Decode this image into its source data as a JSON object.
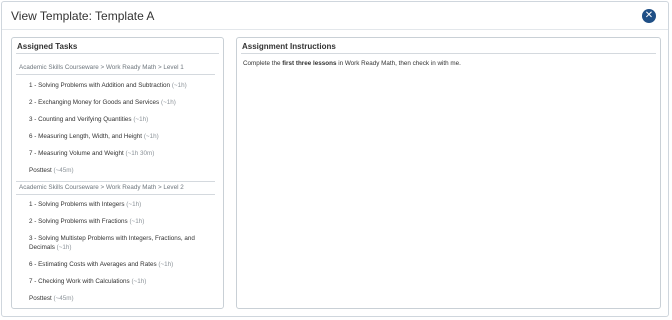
{
  "dialog": {
    "title": "View Template: Template A",
    "close_icon": "close-icon"
  },
  "tasks_panel": {
    "title": "Assigned Tasks",
    "groups": [
      {
        "header": "Academic Skills Courseware > Work Ready Math > Level 1",
        "tasks": [
          {
            "label": "1 - Solving Problems with Addition and Subtraction",
            "duration": "(~1h)"
          },
          {
            "label": "2 - Exchanging Money for Goods and Services",
            "duration": "(~1h)"
          },
          {
            "label": "3 - Counting and Verifying Quantities",
            "duration": "(~1h)"
          },
          {
            "label": "6 - Measuring Length, Width, and Height",
            "duration": "(~1h)"
          },
          {
            "label": "7 - Measuring Volume and Weight",
            "duration": "(~1h 30m)"
          },
          {
            "label": "Posttest",
            "duration": "(~45m)"
          }
        ]
      },
      {
        "header": "Academic Skills Courseware > Work Ready Math > Level 2",
        "tasks": [
          {
            "label": "1 - Solving Problems with Integers",
            "duration": "(~1h)"
          },
          {
            "label": "2 - Solving Problems with Fractions",
            "duration": "(~1h)"
          },
          {
            "label": "3 - Solving Multistep Problems with Integers, Fractions, and Decimals",
            "duration": "(~1h)"
          },
          {
            "label": "6 - Estimating Costs with Averages and Rates",
            "duration": "(~1h)"
          },
          {
            "label": "7 - Checking Work with Calculations",
            "duration": "(~1h)"
          },
          {
            "label": "Posttest",
            "duration": "(~45m)"
          }
        ]
      }
    ]
  },
  "instructions_panel": {
    "title": "Assignment Instructions",
    "text_before": "Complete the ",
    "text_bold": "first three lessons",
    "text_after": " in Work Ready Math, then check in with me."
  }
}
